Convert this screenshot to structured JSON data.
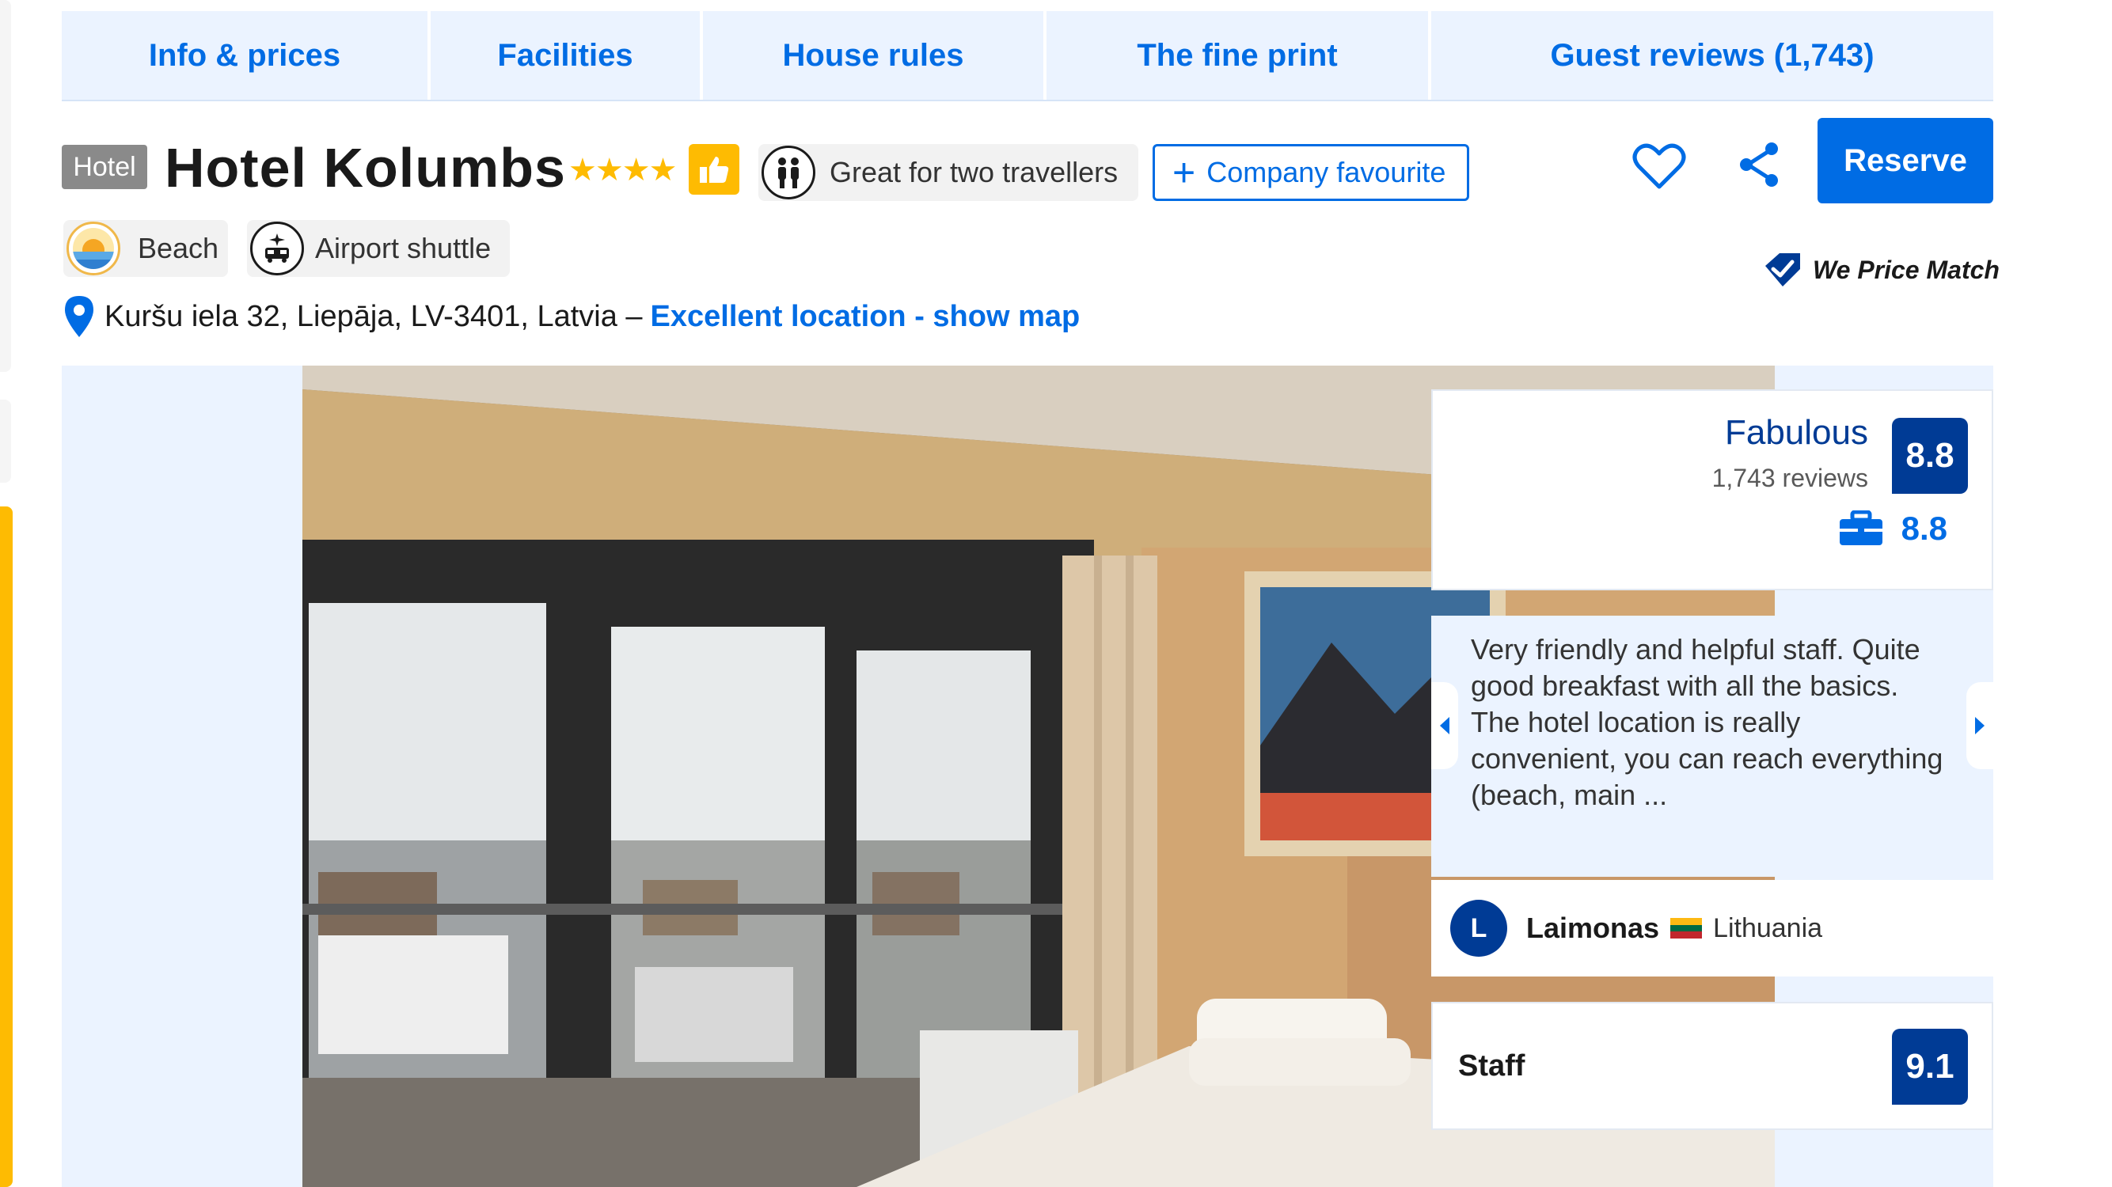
{
  "tabs": [
    {
      "label": "Info & prices"
    },
    {
      "label": "Facilities"
    },
    {
      "label": "House rules"
    },
    {
      "label": "The fine print"
    },
    {
      "label": "Guest reviews (1,743)"
    }
  ],
  "header": {
    "type_badge": "Hotel",
    "name": "Hotel Kolumbs",
    "stars": "★★★★",
    "star_count": 4,
    "great_for": "Great for two travellers",
    "company_favourite": "Company favourite",
    "reserve": "Reserve",
    "price_match": "We Price Match"
  },
  "facilities": [
    {
      "label": "Beach",
      "icon": "beach-icon"
    },
    {
      "label": "Airport shuttle",
      "icon": "airport-shuttle-icon"
    }
  ],
  "address": {
    "text": "Kuršu iela 32, Liepāja, LV-3401, Latvia –",
    "link": "Excellent location - show map"
  },
  "review": {
    "rating_word": "Fabulous",
    "review_count": "1,743 reviews",
    "score": "8.8",
    "business_score": "8.8",
    "quote": "Very friendly and helpful staff. Quite good breakfast with all the basics. The hotel location is really convenient, you can reach everything (beach, main ...",
    "reviewer_initial": "L",
    "reviewer_name": "Laimonas",
    "reviewer_country": "Lithuania",
    "category_label": "Staff",
    "category_score": "9.1"
  },
  "colors": {
    "brand_blue": "#006ce4",
    "dark_blue": "#003b95",
    "yellow": "#febb02",
    "light_blue_bg": "#ebf3ff"
  }
}
